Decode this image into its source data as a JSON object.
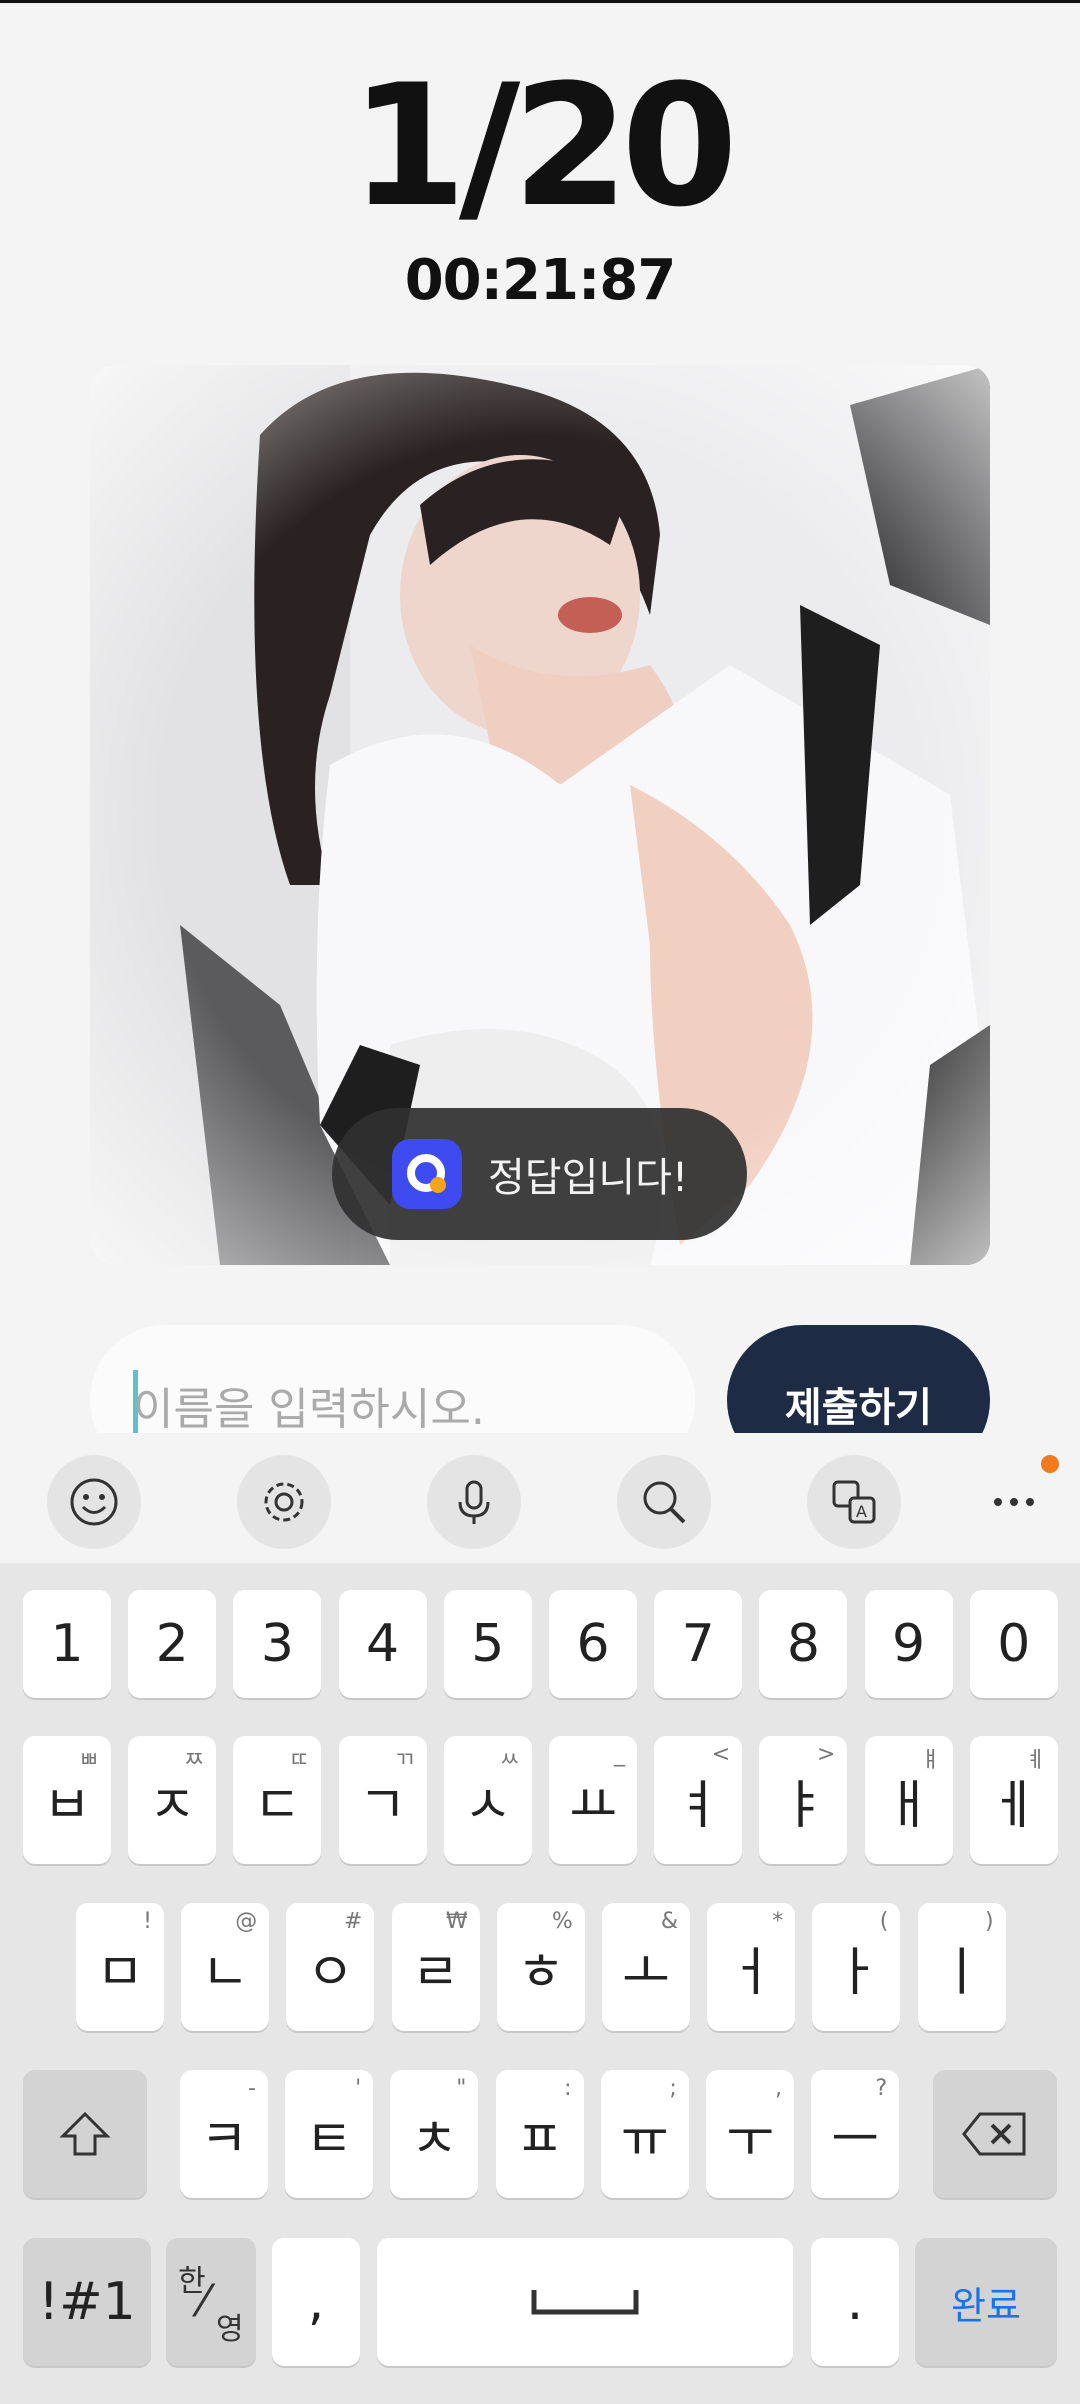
{
  "quiz": {
    "progress": "1/20",
    "timer": "00:21:87"
  },
  "toast": {
    "message": "정답입니다!",
    "icon": "q-app-icon"
  },
  "answer": {
    "placeholder": "이름을 입력하시오.",
    "submit_label": "제출하기"
  },
  "toolbar": {
    "icons": [
      "emoji-icon",
      "settings-icon",
      "microphone-icon",
      "search-icon",
      "translate-icon",
      "more-icon"
    ],
    "notification_color": "#f07a1e"
  },
  "keyboard": {
    "row1": [
      "1",
      "2",
      "3",
      "4",
      "5",
      "6",
      "7",
      "8",
      "9",
      "0"
    ],
    "row2": [
      {
        "main": "ㅂ",
        "sub": "ㅃ"
      },
      {
        "main": "ㅈ",
        "sub": "ㅉ"
      },
      {
        "main": "ㄷ",
        "sub": "ㄸ"
      },
      {
        "main": "ㄱ",
        "sub": "ㄲ"
      },
      {
        "main": "ㅅ",
        "sub": "ㅆ"
      },
      {
        "main": "ㅛ",
        "sub": "_"
      },
      {
        "main": "ㅕ",
        "sub": "<"
      },
      {
        "main": "ㅑ",
        "sub": ">"
      },
      {
        "main": "ㅐ",
        "sub": "ㅒ"
      },
      {
        "main": "ㅔ",
        "sub": "ㅖ"
      }
    ],
    "row3": [
      {
        "main": "ㅁ",
        "sub": "!"
      },
      {
        "main": "ㄴ",
        "sub": "@"
      },
      {
        "main": "ㅇ",
        "sub": "#"
      },
      {
        "main": "ㄹ",
        "sub": "₩"
      },
      {
        "main": "ㅎ",
        "sub": "%"
      },
      {
        "main": "ㅗ",
        "sub": "&"
      },
      {
        "main": "ㅓ",
        "sub": "*"
      },
      {
        "main": "ㅏ",
        "sub": "("
      },
      {
        "main": "ㅣ",
        "sub": ")"
      }
    ],
    "row4": [
      {
        "main": "ㅋ",
        "sub": "-"
      },
      {
        "main": "ㅌ",
        "sub": "'"
      },
      {
        "main": "ㅊ",
        "sub": "\""
      },
      {
        "main": "ㅍ",
        "sub": ":"
      },
      {
        "main": "ㅠ",
        "sub": ";"
      },
      {
        "main": "ㅜ",
        "sub": ","
      },
      {
        "main": "ㅡ",
        "sub": "?"
      }
    ],
    "symbols_label": "!#1",
    "lang_top": "한",
    "lang_bottom": "영",
    "comma": ",",
    "space": "␣",
    "period": ".",
    "done_label": "완료",
    "accent": "#1a73e8"
  }
}
